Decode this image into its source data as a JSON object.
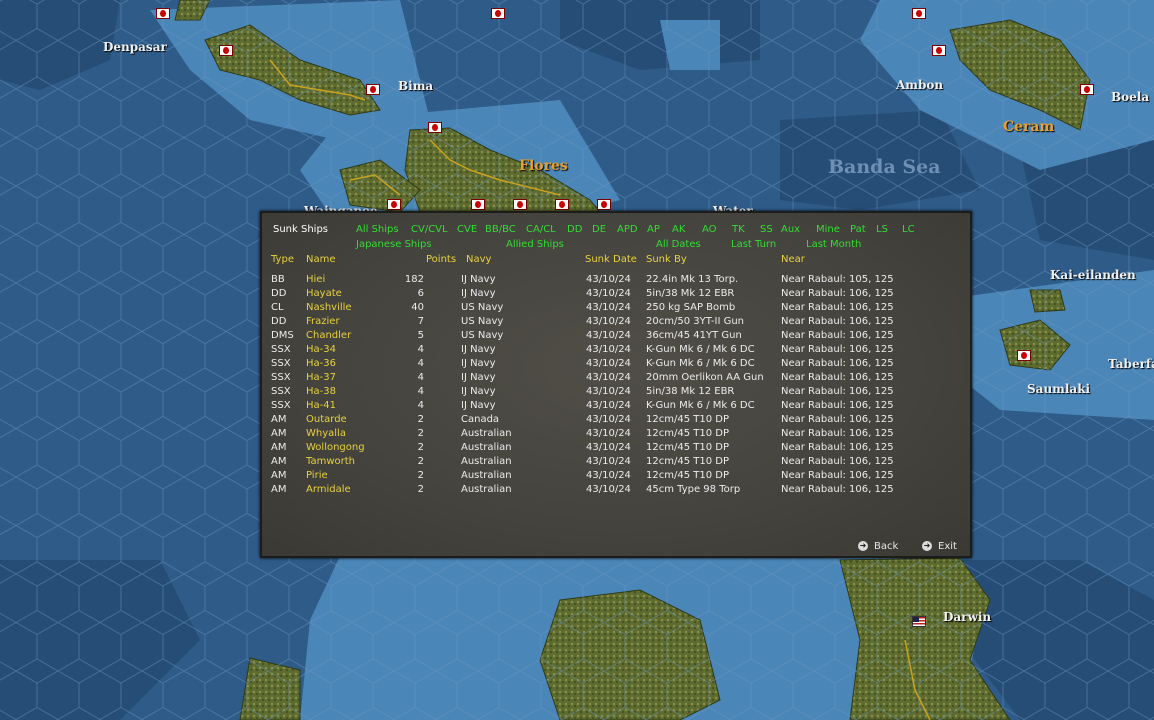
{
  "map_labels": {
    "denpasar": "Denpasar",
    "bima": "Bima",
    "flores": "Flores",
    "ambon": "Ambon",
    "boela": "Boela",
    "ceram": "Ceram",
    "banda_sea": "Banda Sea",
    "kai": "Kai-eilanden",
    "taberfa": "Taberfa",
    "saumlaki": "Saumlaki",
    "darwin": "Darwin",
    "waingapoe": "Waingapoe",
    "water": "Water"
  },
  "panel": {
    "title": "Sunk Ships",
    "filters_row1": [
      "All Ships",
      "CV/CVL",
      "CVE",
      "BB/BC",
      "CA/CL",
      "DD",
      "DE",
      "APD",
      "AP",
      "AK",
      "AO",
      "TK",
      "SS",
      "Aux",
      "Mine",
      "Pat",
      "LS",
      "LC"
    ],
    "filters_row2": [
      "Japanese Ships",
      "Allied Ships",
      "All Dates",
      "Last Turn",
      "Last Month"
    ],
    "columns": [
      "Type",
      "Name",
      "Points",
      "Navy",
      "Sunk Date",
      "Sunk By",
      "Near"
    ],
    "rows": [
      {
        "type": "BB",
        "name": "Hiei",
        "points": "182",
        "navy": "IJ Navy",
        "date": "43/10/24",
        "by": "22.4in Mk 13 Torp.",
        "near": "Near Rabaul: 105, 125"
      },
      {
        "type": "DD",
        "name": "Hayate",
        "points": "6",
        "navy": "IJ Navy",
        "date": "43/10/24",
        "by": "5in/38 Mk 12 EBR",
        "near": "Near Rabaul: 106, 125"
      },
      {
        "type": "CL",
        "name": "Nashville",
        "points": "40",
        "navy": "US Navy",
        "date": "43/10/24",
        "by": "250 kg SAP Bomb",
        "near": "Near Rabaul: 106, 125"
      },
      {
        "type": "DD",
        "name": "Frazier",
        "points": "7",
        "navy": "US Navy",
        "date": "43/10/24",
        "by": "20cm/50 3YT-II Gun",
        "near": "Near Rabaul: 106, 125"
      },
      {
        "type": "DMS",
        "name": "Chandler",
        "points": "5",
        "navy": "US Navy",
        "date": "43/10/24",
        "by": "36cm/45 41YT Gun",
        "near": "Near Rabaul: 106, 125"
      },
      {
        "type": "SSX",
        "name": "Ha-34",
        "points": "4",
        "navy": "IJ Navy",
        "date": "43/10/24",
        "by": "K-Gun Mk 6 / Mk 6 DC",
        "near": "Near Rabaul: 106, 125"
      },
      {
        "type": "SSX",
        "name": "Ha-36",
        "points": "4",
        "navy": "IJ Navy",
        "date": "43/10/24",
        "by": "K-Gun Mk 6 / Mk 6 DC",
        "near": "Near Rabaul: 106, 125"
      },
      {
        "type": "SSX",
        "name": "Ha-37",
        "points": "4",
        "navy": "IJ Navy",
        "date": "43/10/24",
        "by": "20mm Oerlikon AA Gun",
        "near": "Near Rabaul: 106, 125"
      },
      {
        "type": "SSX",
        "name": "Ha-38",
        "points": "4",
        "navy": "IJ Navy",
        "date": "43/10/24",
        "by": "5in/38 Mk 12 EBR",
        "near": "Near Rabaul: 106, 125"
      },
      {
        "type": "SSX",
        "name": "Ha-41",
        "points": "4",
        "navy": "IJ Navy",
        "date": "43/10/24",
        "by": "K-Gun Mk 6 / Mk 6 DC",
        "near": "Near Rabaul: 106, 125"
      },
      {
        "type": "AM",
        "name": "Outarde",
        "points": "2",
        "navy": "Canada",
        "date": "43/10/24",
        "by": "12cm/45 T10 DP",
        "near": "Near Rabaul: 106, 125"
      },
      {
        "type": "AM",
        "name": "Whyalla",
        "points": "2",
        "navy": "Australian",
        "date": "43/10/24",
        "by": "12cm/45 T10 DP",
        "near": "Near Rabaul: 106, 125"
      },
      {
        "type": "AM",
        "name": "Wollongong",
        "points": "2",
        "navy": "Australian",
        "date": "43/10/24",
        "by": "12cm/45 T10 DP",
        "near": "Near Rabaul: 106, 125"
      },
      {
        "type": "AM",
        "name": "Tamworth",
        "points": "2",
        "navy": "Australian",
        "date": "43/10/24",
        "by": "12cm/45 T10 DP",
        "near": "Near Rabaul: 106, 125"
      },
      {
        "type": "AM",
        "name": "Pirie",
        "points": "2",
        "navy": "Australian",
        "date": "43/10/24",
        "by": "12cm/45 T10 DP",
        "near": "Near Rabaul: 106, 125"
      },
      {
        "type": "AM",
        "name": "Armidale",
        "points": "2",
        "navy": "Australian",
        "date": "43/10/24",
        "by": "45cm Type 98 Torp",
        "near": "Near Rabaul: 106, 125"
      }
    ],
    "back_label": "Back",
    "exit_label": "Exit"
  },
  "colors": {
    "filter": "#33dd33",
    "header": "#e8d23c",
    "name": "#e8d23c",
    "text": "#ececec",
    "panel_bg": "#46453f",
    "sea_deep": "#2d5a86",
    "sea_shallow": "#4a86b8",
    "land": "#6e7a3c"
  }
}
